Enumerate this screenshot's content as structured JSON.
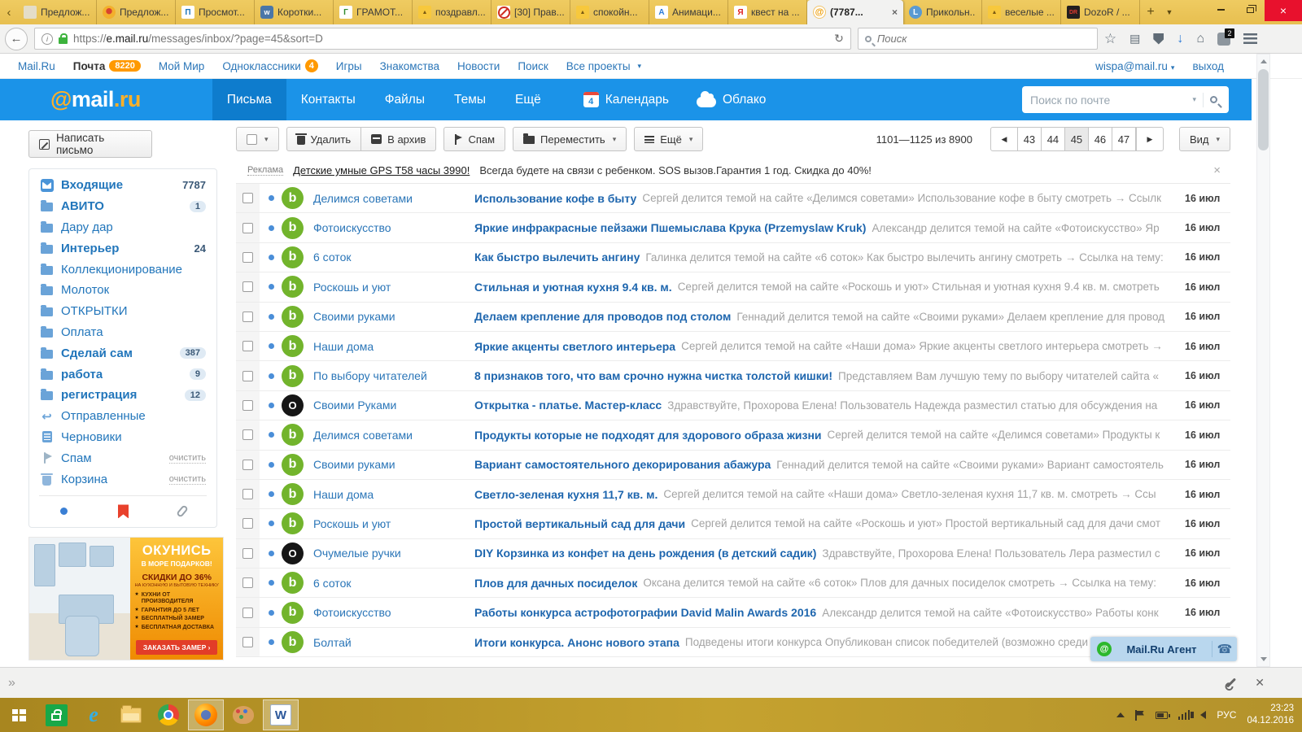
{
  "colors": {
    "header_blue": "#1b93e8",
    "active_nav_blue": "#0e7ccd",
    "link_blue": "#2b76b8",
    "subject_blue": "#1e66ae",
    "unread_dot": "#4a8ed8",
    "avatar_green": "#72b42c",
    "avatar_black": "#161616",
    "badge_orange": "#ff9900",
    "tab_strip_gold": "#e9c353",
    "taskbar_gold": "#b3922b",
    "close_red": "#e8112d"
  },
  "browser": {
    "tabs": [
      {
        "title": "Предлож...",
        "cls": "",
        "fav": "fav-doc",
        "glyph": ""
      },
      {
        "title": "Предлож...",
        "cls": "",
        "fav": "fav-medal",
        "glyph": ""
      },
      {
        "title": "Просмот...",
        "cls": "",
        "fav": "fav-blue-p",
        "glyph": "П"
      },
      {
        "title": "Коротки...",
        "cls": "",
        "fav": "fav-vk",
        "glyph": "w"
      },
      {
        "title": "ГРАМОТ...",
        "cls": "",
        "fav": "fav-gram",
        "glyph": "Г"
      },
      {
        "title": "поздравл...",
        "cls": "",
        "fav": "fav-img",
        "glyph": "▲"
      },
      {
        "title": "[30] Прав...",
        "cls": "",
        "fav": "fav-nosign",
        "glyph": ""
      },
      {
        "title": "спокойн...",
        "cls": "",
        "fav": "fav-img",
        "glyph": "▲"
      },
      {
        "title": "Анимаци...",
        "cls": "",
        "fav": "fav-anim",
        "glyph": "А"
      },
      {
        "title": "квест на ...",
        "cls": "",
        "fav": "fav-ya",
        "glyph": "Я"
      },
      {
        "title": "(7787...",
        "cls": "active",
        "fav": "fav-mail",
        "glyph": "@"
      },
      {
        "title": "Прикольн...",
        "cls": "",
        "fav": "fav-li",
        "glyph": "L"
      },
      {
        "title": "веселые ...",
        "cls": "",
        "fav": "fav-img",
        "glyph": "▲"
      },
      {
        "title": "DozoR / ...",
        "cls": "",
        "fav": "fav-dozor",
        "glyph": "DR"
      }
    ],
    "url": {
      "prefix": "https://",
      "domain": "e.mail.ru",
      "path": "/messages/inbox/?page=45&sort=D"
    },
    "search_placeholder": "Поиск",
    "downloads_badge": "2"
  },
  "portal_nav": {
    "items": [
      {
        "label": "Mail.Ru",
        "cls": "",
        "badge": "",
        "badge_cls": ""
      },
      {
        "label": "Почта",
        "cls": "current",
        "badge": "8220",
        "badge_cls": "pill"
      },
      {
        "label": "Мой Мир",
        "cls": "",
        "badge": "",
        "badge_cls": ""
      },
      {
        "label": "Одноклассники",
        "cls": "",
        "badge": "4",
        "badge_cls": "round"
      },
      {
        "label": "Игры",
        "cls": "",
        "badge": "",
        "badge_cls": ""
      },
      {
        "label": "Знакомства",
        "cls": "",
        "badge": "",
        "badge_cls": ""
      },
      {
        "label": "Новости",
        "cls": "",
        "badge": "",
        "badge_cls": ""
      },
      {
        "label": "Поиск",
        "cls": "",
        "badge": "",
        "badge_cls": ""
      },
      {
        "label": "Все проекты",
        "cls": "car",
        "badge": "",
        "badge_cls": ""
      }
    ],
    "user": "wispa@mail.ru",
    "logout": "выход"
  },
  "header": {
    "logo": {
      "at": "@",
      "name": "mail",
      "tld": ".ru"
    },
    "nav": [
      {
        "label": "Письма",
        "cls": "on"
      },
      {
        "label": "Контакты",
        "cls": ""
      },
      {
        "label": "Файлы",
        "cls": ""
      },
      {
        "label": "Темы",
        "cls": ""
      },
      {
        "label": "Ещё",
        "cls": ""
      }
    ],
    "calendar": {
      "label": "Календарь",
      "badge": "4"
    },
    "cloud": {
      "label": "Облако"
    },
    "search_placeholder": "Поиск по почте"
  },
  "sidebar": {
    "compose": "Написать письмо",
    "folders": [
      {
        "label": "Входящие",
        "icon": "ic-inbox",
        "cls": "bold",
        "count": "7787",
        "count_cls": "plain",
        "action": ""
      },
      {
        "label": "АВИТО",
        "icon": "ic-folder",
        "cls": "bold",
        "count": "1",
        "count_cls": "pill",
        "action": ""
      },
      {
        "label": "Дару дар",
        "icon": "ic-folder",
        "cls": "",
        "count": "",
        "count_cls": "",
        "action": ""
      },
      {
        "label": "Интерьер",
        "icon": "ic-folder",
        "cls": "bold",
        "count": "24",
        "count_cls": "plain",
        "action": ""
      },
      {
        "label": "Коллекционирование",
        "icon": "ic-folder",
        "cls": "",
        "count": "",
        "count_cls": "",
        "action": ""
      },
      {
        "label": "Молоток",
        "icon": "ic-folder",
        "cls": "",
        "count": "",
        "count_cls": "",
        "action": ""
      },
      {
        "label": "ОТКРЫТКИ",
        "icon": "ic-folder",
        "cls": "",
        "count": "",
        "count_cls": "",
        "action": ""
      },
      {
        "label": "Оплата",
        "icon": "ic-folder",
        "cls": "",
        "count": "",
        "count_cls": "",
        "action": ""
      },
      {
        "label": "Сделай сам",
        "icon": "ic-folder",
        "cls": "bold",
        "count": "387",
        "count_cls": "pill",
        "action": ""
      },
      {
        "label": "работа",
        "icon": "ic-folder",
        "cls": "bold",
        "count": "9",
        "count_cls": "pill",
        "action": ""
      },
      {
        "label": "регистрация",
        "icon": "ic-folder",
        "cls": "bold",
        "count": "12",
        "count_cls": "pill",
        "action": ""
      },
      {
        "label": "Отправленные",
        "icon": "ic-sent",
        "cls": "",
        "count": "",
        "count_cls": "",
        "action": ""
      },
      {
        "label": "Черновики",
        "icon": "ic-draft",
        "cls": "",
        "count": "",
        "count_cls": "",
        "action": ""
      },
      {
        "label": "Спам",
        "icon": "ic-spam",
        "cls": "",
        "count": "",
        "count_cls": "",
        "action": "очистить"
      },
      {
        "label": "Корзина",
        "icon": "ic-trash",
        "cls": "",
        "count": "",
        "count_cls": "",
        "action": "очистить"
      }
    ],
    "ad": {
      "line1": "ОКУНИСЬ",
      "line2": "В МОРЕ ПОДАРКОВ!",
      "line3": "СКИДКИ ДО 36%",
      "line4": "НА КУХОННУЮ И БЫТОВУЮ ТЕХНИКУ",
      "bullets": [
        "КУХНИ ОТ ПРОИЗВОДИТЕЛЯ",
        "ГАРАНТИЯ ДО 5 ЛЕТ",
        "БЕСПЛАТНЫЙ ЗАМЕР",
        "БЕСПЛАТНАЯ ДОСТАВКА"
      ],
      "cta": "ЗАКАЗАТЬ ЗАМЕР ›"
    }
  },
  "toolbar": {
    "delete": "Удалить",
    "archive": "В архив",
    "spam": "Спам",
    "move": "Переместить",
    "more": "Ещё"
  },
  "pagination": {
    "range": "1101—1125 из 8900",
    "pages": [
      {
        "label": "43",
        "cls": ""
      },
      {
        "label": "44",
        "cls": ""
      },
      {
        "label": "45",
        "cls": "on"
      },
      {
        "label": "46",
        "cls": ""
      },
      {
        "label": "47",
        "cls": ""
      }
    ],
    "view": "Вид"
  },
  "ad_line": {
    "label": "Реклама",
    "link": "Детские умные GPS T58 часы 3990!",
    "text": "Всегда будете на связи с ребенком. SOS вызов.Гарантия 1 год. Скидка до 40%!"
  },
  "emails": [
    {
      "sender": "Делимся советами",
      "av": "b",
      "av_cls": "av-g",
      "subject": "Использование кофе в быту",
      "snippet": "Сергей делится темой на сайте «Делимся советами» Использование кофе в быту смотреть → Ссылк",
      "date": "16 июл"
    },
    {
      "sender": "Фотоискусство",
      "av": "b",
      "av_cls": "av-g",
      "subject": "Яркие инфракрасные пейзажи Пшемыслава Крука (Przemyslaw Kruk)",
      "snippet": "Александр делится темой на сайте «Фотоискусство» Яр",
      "date": "16 июл"
    },
    {
      "sender": "6 соток",
      "av": "b",
      "av_cls": "av-g",
      "subject": "Как быстро вылечить ангину",
      "snippet": "Галинка делится темой на сайте «6 соток» Как быстро вылечить ангину смотреть → Ссылка на тему:",
      "date": "16 июл"
    },
    {
      "sender": "Роскошь и уют",
      "av": "b",
      "av_cls": "av-g",
      "subject": "Стильная и уютная кухня 9.4 кв. м.",
      "snippet": "Сергей делится темой на сайте «Роскошь и уют» Стильная и уютная кухня 9.4 кв. м. смотреть",
      "date": "16 июл"
    },
    {
      "sender": "Своими руками",
      "av": "b",
      "av_cls": "av-g",
      "subject": "Делаем крепление для проводов под столом",
      "snippet": "Геннадий делится темой на сайте «Своими руками» Делаем крепление для провод",
      "date": "16 июл"
    },
    {
      "sender": "Наши дома",
      "av": "b",
      "av_cls": "av-g",
      "subject": "Яркие акценты светлого интерьера",
      "snippet": "Сергей делится темой на сайте «Наши дома» Яркие акценты светлого интерьера смотреть →",
      "date": "16 июл"
    },
    {
      "sender": "По выбору читателей",
      "av": "b",
      "av_cls": "av-g",
      "subject": "8 признаков того, что вам срочно нужна чистка толстой кишки!",
      "snippet": "Представляем Вам лучшую тему по выбору читателей сайта «",
      "date": "16 июл"
    },
    {
      "sender": "Своими Руками",
      "av": "O",
      "av_cls": "av-k",
      "subject": "Открытка - платье. Мастер-класс",
      "snippet": "Здравствуйте, Прохорова Елена! Пользователь Надежда разместил статью для обсуждения на",
      "date": "16 июл"
    },
    {
      "sender": "Делимся советами",
      "av": "b",
      "av_cls": "av-g",
      "subject": "Продукты которые не подходят для здорового образа жизни",
      "snippet": "Сергей делится темой на сайте «Делимся советами» Продукты к",
      "date": "16 июл"
    },
    {
      "sender": "Своими руками",
      "av": "b",
      "av_cls": "av-g",
      "subject": "Вариант самостоятельного декорирования абажура",
      "snippet": "Геннадий делится темой на сайте «Своими руками» Вариант самостоятель",
      "date": "16 июл"
    },
    {
      "sender": "Наши дома",
      "av": "b",
      "av_cls": "av-g",
      "subject": "Светло-зеленая кухня 11,7 кв. м.",
      "snippet": "Сергей делится темой на сайте «Наши дома» Светло-зеленая кухня 11,7 кв. м. смотреть → Ссы",
      "date": "16 июл"
    },
    {
      "sender": "Роскошь и уют",
      "av": "b",
      "av_cls": "av-g",
      "subject": "Простой вертикальный сад для дачи",
      "snippet": "Сергей делится темой на сайте «Роскошь и уют» Простой вертикальный сад для дачи смот",
      "date": "16 июл"
    },
    {
      "sender": "Очумелые ручки",
      "av": "O",
      "av_cls": "av-k",
      "subject": "DIY Корзинка из конфет на день рождения (в детский садик)",
      "snippet": "Здравствуйте, Прохорова Елена! Пользователь Лера разместил с",
      "date": "16 июл"
    },
    {
      "sender": "6 соток",
      "av": "b",
      "av_cls": "av-g",
      "subject": "Плов для дачных посиделок",
      "snippet": "Оксана делится темой на сайте «6 соток» Плов для дачных посиделок смотреть → Ссылка на тему:",
      "date": "16 июл"
    },
    {
      "sender": "Фотоискусство",
      "av": "b",
      "av_cls": "av-g",
      "subject": "Работы конкурса астрофотографии David Malin Awards 2016",
      "snippet": "Александр делится темой на сайте «Фотоискусство» Работы конк",
      "date": "16 июл"
    },
    {
      "sender": "Болтай",
      "av": "b",
      "av_cls": "av-g",
      "subject": "Итоги конкурса. Анонс нового этапа",
      "snippet": "Подведены итоги конкурса Опубликован список победителей (возможно среди ни",
      "date": "16 июл"
    }
  ],
  "agent": {
    "label": "Mail.Ru Агент"
  },
  "taskbar": {
    "lang": "РУС",
    "time": "23:23",
    "date": "04.12.2016"
  }
}
